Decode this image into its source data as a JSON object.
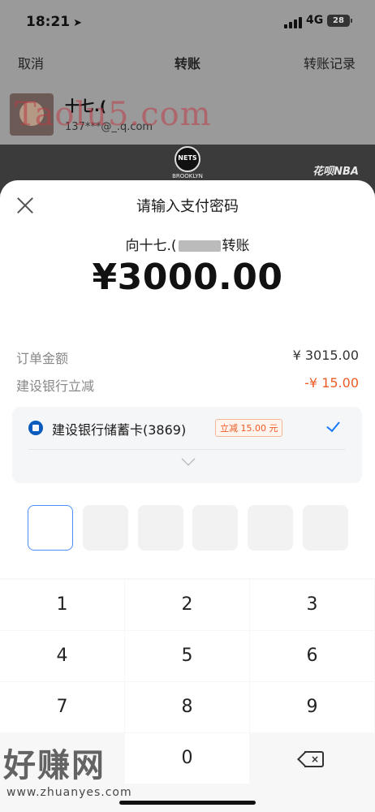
{
  "status_bar": {
    "time": "18:21",
    "network": "4G",
    "battery": "28"
  },
  "background": {
    "cancel": "取消",
    "title": "转账",
    "records": "转账记录",
    "user_name": "十七.(",
    "user_email": "137***@_.q.com"
  },
  "promo": {
    "team_top": "NETS",
    "team_bottom": "BROOKLYN",
    "huabei": "花呗NBA"
  },
  "sheet": {
    "title": "请输入支付密码",
    "transfer_prefix": "向十七.(",
    "transfer_suffix": "转账",
    "amount": "¥3000.00",
    "order_label": "订单金额",
    "order_value": "¥ 3015.00",
    "discount_label": "建设银行立减",
    "discount_value": "-¥ 15.00",
    "card_name": "建设银行储蓄卡(3869)",
    "card_discount": "立减 15.00 元"
  },
  "keypad": {
    "keys": [
      "1",
      "2",
      "3",
      "4",
      "5",
      "6",
      "7",
      "8",
      "9",
      "0"
    ]
  },
  "watermarks": {
    "top": "Taolu5.com",
    "bottom": "好赚网",
    "url": "www.zhuanyes.com"
  }
}
